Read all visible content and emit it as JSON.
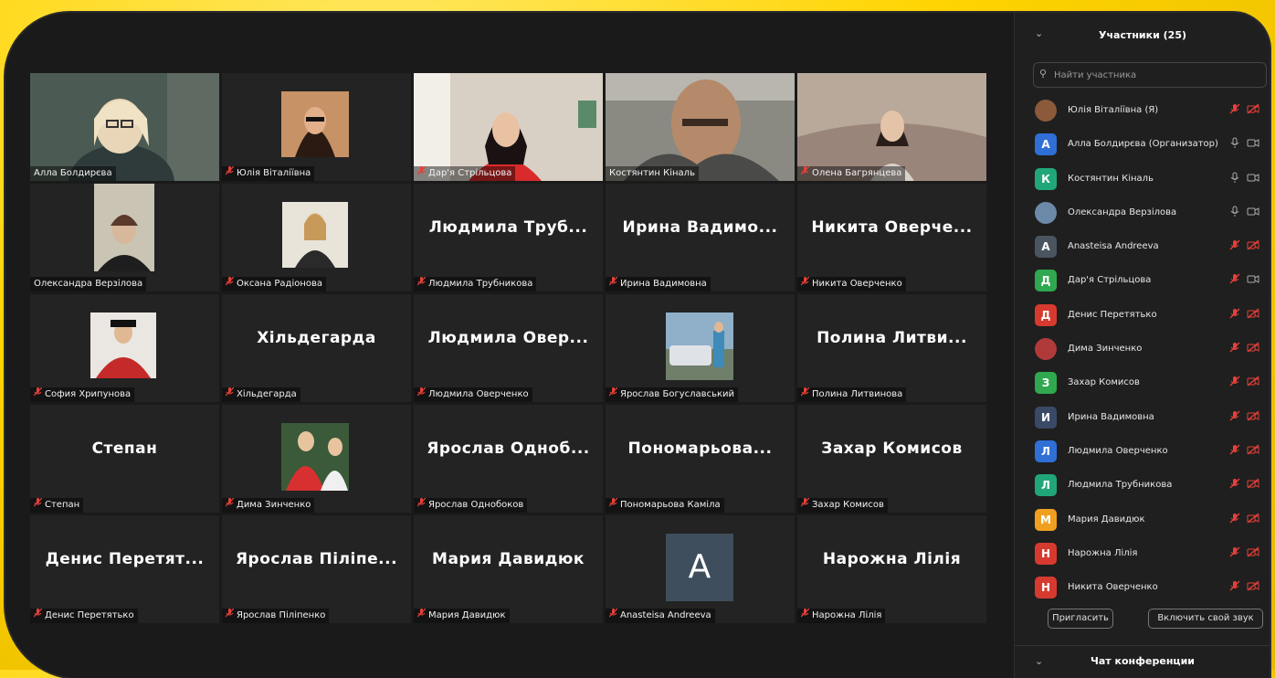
{
  "colors": {
    "accent_frame": "#c6e35a",
    "muted_red": "#e5413a",
    "tile_bg": "#232323",
    "panel_bg": "#1f1f1f"
  },
  "tiles": [
    {
      "big": "",
      "label": "Алла Болдирєва",
      "muted": false,
      "video": "alla"
    },
    {
      "big": "",
      "label": "Юлія Віталіївна",
      "muted": true,
      "video": "yulia"
    },
    {
      "big": "",
      "label": "Дар'я Стрільцова",
      "muted": true,
      "video": "darya"
    },
    {
      "big": "",
      "label": "Костянтин Кіналь",
      "muted": false,
      "video": "kostya"
    },
    {
      "big": "",
      "label": "Олена Багрянцева",
      "muted": true,
      "video": "olena"
    },
    {
      "big": "",
      "label": "Олександра Верзілова",
      "muted": false,
      "video": "oleksandra"
    },
    {
      "big": "",
      "label": "Оксана Радіонова",
      "muted": true,
      "video": "oksana"
    },
    {
      "big": "Людмила Труб...",
      "label": "Людмила Трубникова",
      "muted": true
    },
    {
      "big": "Ирина Вадимо...",
      "label": "Ирина Вадимовна",
      "muted": true
    },
    {
      "big": "Никита Оверче...",
      "label": "Никита Оверченко",
      "muted": true
    },
    {
      "big": "",
      "label": "София Хрипунова",
      "muted": true,
      "video": "sofia"
    },
    {
      "big": "Хільдегарда",
      "label": "Хільдегарда",
      "muted": true
    },
    {
      "big": "Людмила Овер...",
      "label": "Людмила Оверченко",
      "muted": true
    },
    {
      "big": "",
      "label": "Ярослав Богуславський",
      "muted": true,
      "video": "yaroslav"
    },
    {
      "big": "Полина Литви...",
      "label": "Полина Литвинова",
      "muted": true
    },
    {
      "big": "Степан",
      "label": "Степан",
      "muted": true
    },
    {
      "big": "",
      "label": "Дима Зинченко",
      "muted": true,
      "video": "dima"
    },
    {
      "big": "Ярослав Одноб...",
      "label": "Ярослав Однобоков",
      "muted": true
    },
    {
      "big": "Пономарьова...",
      "label": "Пономарьова Каміла",
      "muted": true
    },
    {
      "big": "Захар Комисов",
      "label": "Захар Комисов",
      "muted": true
    },
    {
      "big": "Денис Перетят...",
      "label": "Денис Перетятько",
      "muted": true
    },
    {
      "big": "Ярослав Піліпе...",
      "label": "Ярослав Піліпенко",
      "muted": true
    },
    {
      "big": "Мария Давидюк",
      "label": "Мария Давидюк",
      "muted": true
    },
    {
      "big": "",
      "label": "Anasteisa Andreeva",
      "muted": true,
      "avatar": "A"
    },
    {
      "big": "Нарожна Лілія",
      "label": "Нарожна Лілія",
      "muted": true
    }
  ],
  "panel": {
    "title": "Участники (25)",
    "search_placeholder": "Найти участника",
    "participants": [
      {
        "initial": "",
        "photo": true,
        "color": "#8a5a3a",
        "name": "Юлія Віталіївна (Я)",
        "mic": "muted",
        "cam": "off"
      },
      {
        "initial": "А",
        "color": "#2f6fd6",
        "name": "Алла Болдирєва (Организатор)",
        "mic": "on",
        "cam": "on"
      },
      {
        "initial": "К",
        "color": "#21a67a",
        "name": "Костянтин Кіналь",
        "mic": "on",
        "cam": "on"
      },
      {
        "initial": "",
        "photo": true,
        "color": "#6c8aa8",
        "name": "Олександра Верзілова",
        "mic": "on",
        "cam": "on"
      },
      {
        "initial": "A",
        "color": "#4a5560",
        "name": "Anasteisa Andreeva",
        "mic": "muted",
        "cam": "off"
      },
      {
        "initial": "Д",
        "color": "#2fa84f",
        "name": "Дар'я Стрільцова",
        "mic": "muted",
        "cam": "on"
      },
      {
        "initial": "Д",
        "color": "#d63a2f",
        "name": "Денис Перетятько",
        "mic": "muted",
        "cam": "off"
      },
      {
        "initial": "",
        "photo": true,
        "color": "#b03a3a",
        "name": "Дима Зинченко",
        "mic": "muted",
        "cam": "off"
      },
      {
        "initial": "З",
        "color": "#2fa84f",
        "name": "Захар Комисов",
        "mic": "muted",
        "cam": "off"
      },
      {
        "initial": "И",
        "color": "#3a4a66",
        "name": "Ирина Вадимовна",
        "mic": "muted",
        "cam": "off"
      },
      {
        "initial": "Л",
        "color": "#2f6fd6",
        "name": "Людмила Оверченко",
        "mic": "muted",
        "cam": "off"
      },
      {
        "initial": "Л",
        "color": "#21a67a",
        "name": "Людмила Трубникова",
        "mic": "muted",
        "cam": "off"
      },
      {
        "initial": "М",
        "color": "#f0a020",
        "name": "Мария Давидюк",
        "mic": "muted",
        "cam": "off"
      },
      {
        "initial": "Н",
        "color": "#d63a2f",
        "name": "Нарожна Лілія",
        "mic": "muted",
        "cam": "off"
      },
      {
        "initial": "Н",
        "color": "#d63a2f",
        "name": "Никита Оверченко",
        "mic": "muted",
        "cam": "off"
      }
    ],
    "invite_label": "Пригласить",
    "unmute_label": "Включить свой звук",
    "chat_title": "Чат конференции"
  }
}
